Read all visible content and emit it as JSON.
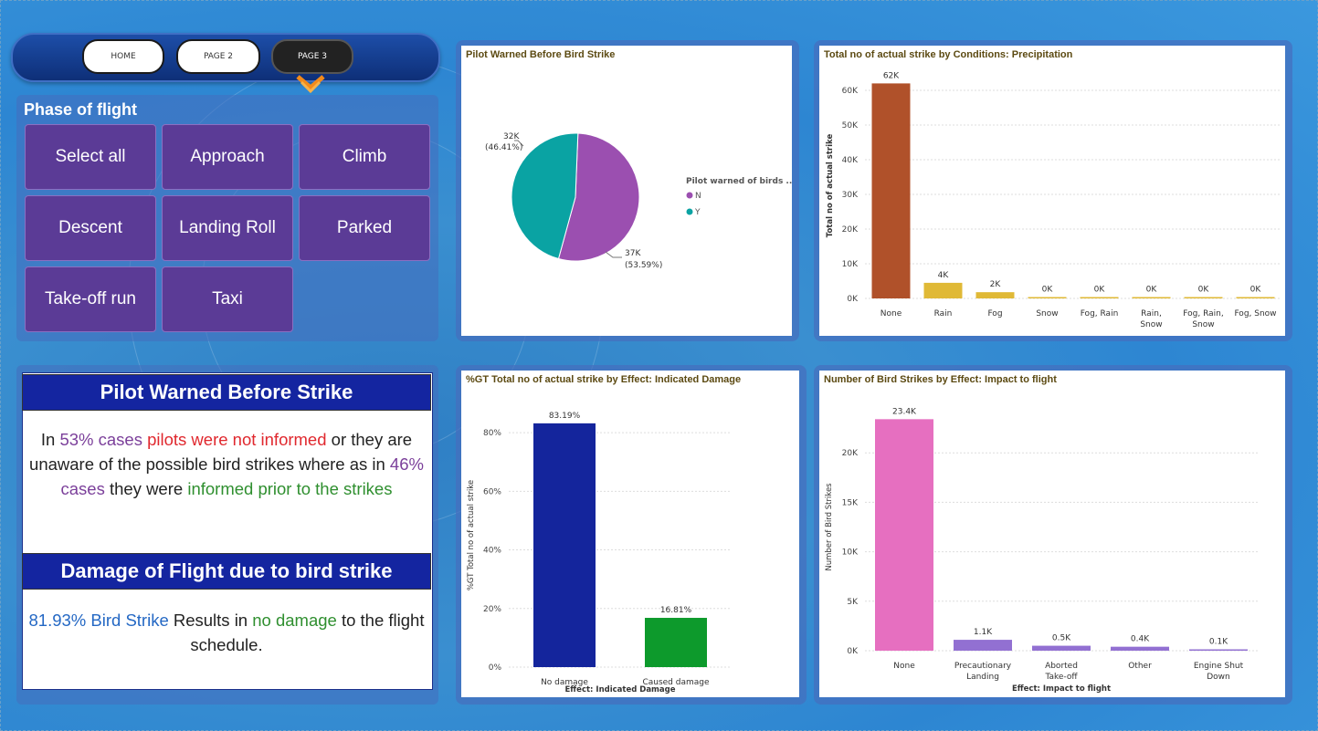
{
  "nav": {
    "home": "HOME",
    "page2": "PAGE 2",
    "page3": "PAGE 3"
  },
  "phase": {
    "title": "Phase of flight",
    "tiles": [
      "Select all",
      "Approach",
      "Climb",
      "Descent",
      "Landing Roll",
      "Parked",
      "Take-off run",
      "Taxi"
    ]
  },
  "pilot_card": {
    "heading": "Pilot Warned Before Strike",
    "t1": "In ",
    "t2": "53% cases ",
    "t3": "pilots were not informed",
    "t4": " or they are unaware of the possible bird strikes where as in ",
    "t5": "46% cases",
    "t6": " they were ",
    "t7": "informed prior to the strikes"
  },
  "damage_card": {
    "heading": "Damage of Flight due to bird strike",
    "t1": "81.93% Bird Strike",
    "t2": " Results in ",
    "t3": "no damage",
    "t4": " to the flight schedule."
  },
  "colors": {
    "pie_n": "#9b4fb0",
    "pie_y": "#0aa3a3",
    "precip_none": "#b0512a",
    "precip_other": "#e0b936",
    "damage_no": "#14259c",
    "damage_yes": "#0d9a2c",
    "impact_none": "#e66fc0",
    "impact_other": "#9270d2"
  },
  "chart_data": [
    {
      "type": "pie",
      "title": "Pilot Warned Before Bird Strike",
      "legend_title": "Pilot warned of birds ...",
      "slices": [
        {
          "label": "N",
          "value": 37,
          "display": "37K",
          "pct": "(53.59%)"
        },
        {
          "label": "Y",
          "value": 32,
          "display": "32K",
          "pct": "(46.41%)"
        }
      ]
    },
    {
      "type": "bar",
      "title": "Total no of actual strike by Conditions: Precipitation",
      "ylabel": "Total no of actual strike",
      "xlabel": "",
      "categories": [
        "None",
        "Rain",
        "Fog",
        "Snow",
        "Fog, Rain",
        "Rain, Snow",
        "Fog, Rain, Snow",
        "Fog, Snow"
      ],
      "values": [
        62,
        4.5,
        1.8,
        0.2,
        0.1,
        0.05,
        0.02,
        0.01
      ],
      "labels": [
        "62K",
        "4K",
        "2K",
        "0K",
        "0K",
        "0K",
        "0K",
        "0K"
      ],
      "yticks": [
        "0K",
        "10K",
        "20K",
        "30K",
        "40K",
        "50K",
        "60K"
      ],
      "ylim": [
        0,
        65
      ]
    },
    {
      "type": "bar",
      "title": "%GT Total no of actual strike by Effect: Indicated Damage",
      "ylabel": "%GT Total no of actual strike",
      "xlabel": "Effect: Indicated Damage",
      "categories": [
        "No damage",
        "Caused damage"
      ],
      "values": [
        83.19,
        16.81
      ],
      "labels": [
        "83.19%",
        "16.81%"
      ],
      "yticks": [
        "0%",
        "20%",
        "40%",
        "60%",
        "80%"
      ],
      "ylim": [
        0,
        90
      ]
    },
    {
      "type": "bar",
      "title": "Number of Bird Strikes by Effect: Impact to flight",
      "ylabel": "Number of Bird Strikes",
      "xlabel": "Effect: Impact to flight",
      "categories": [
        "None",
        "Precautionary Landing",
        "Aborted Take-off",
        "Other",
        "Engine Shut Down"
      ],
      "values": [
        23.4,
        1.1,
        0.5,
        0.4,
        0.1
      ],
      "labels": [
        "23.4K",
        "1.1K",
        "0.5K",
        "0.4K",
        "0.1K"
      ],
      "yticks": [
        "0K",
        "5K",
        "10K",
        "15K",
        "20K"
      ],
      "ylim": [
        0,
        25
      ]
    }
  ]
}
